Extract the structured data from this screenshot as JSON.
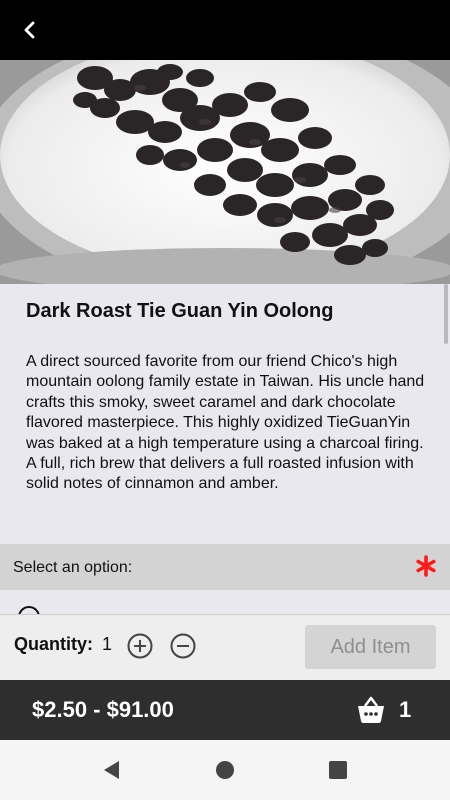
{
  "product": {
    "title": "Dark Roast Tie Guan Yin Oolong",
    "description": "A direct sourced favorite from our friend Chico's high mountain oolong family estate in Taiwan. His uncle hand crafts this smoky, sweet caramel and dark chocolate flavored masterpiece. This highly oxidized TieGuanYin was baked at a high temperature using a charcoal firing.  A full, rich brew that delivers a full roasted infusion with solid notes of cinnamon and amber."
  },
  "options": {
    "label": "Select an option:",
    "required_color": "#ff1a1a"
  },
  "quantity": {
    "label": "Quantity:",
    "value": "1",
    "add_label": "Add Item"
  },
  "footer": {
    "price_range": "$2.50 - $91.00",
    "cart_count": "1"
  },
  "icons": {
    "back": "chevron-left-icon",
    "plus": "plus-circle-icon",
    "minus": "minus-circle-icon",
    "cart": "basket-icon"
  }
}
